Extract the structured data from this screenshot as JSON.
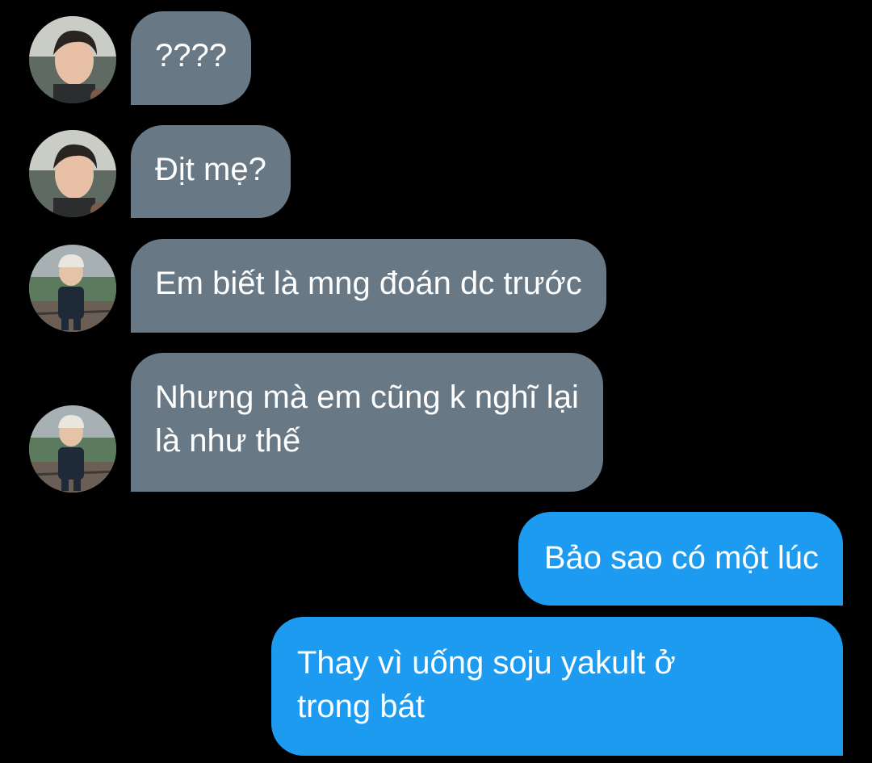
{
  "conversation": {
    "messages": [
      {
        "sender": "avatar-a",
        "direction": "incoming",
        "lines": [
          "????"
        ]
      },
      {
        "sender": "avatar-a",
        "direction": "incoming",
        "lines": [
          "Địt mẹ?"
        ]
      },
      {
        "sender": "avatar-b",
        "direction": "incoming",
        "lines": [
          "Em biết là mng đoán dc trước"
        ]
      },
      {
        "sender": "avatar-b",
        "direction": "incoming",
        "lines": [
          "Nhưng mà em cũng k nghĩ lại",
          "là như thế"
        ]
      },
      {
        "sender": "me",
        "direction": "outgoing",
        "lines": [
          "Bảo sao có một lúc"
        ]
      },
      {
        "sender": "me",
        "direction": "outgoing",
        "lines": [
          "Thay vì uống soju yakult ở",
          "trong bát"
        ]
      }
    ]
  },
  "colors": {
    "background": "#000000",
    "incoming_bubble": "#687885",
    "outgoing_bubble": "#1d9bf0",
    "text": "#ffffff"
  },
  "icons": {
    "avatar_a": "profile-photo-young-man-icon",
    "avatar_b": "profile-photo-child-with-cap-icon"
  }
}
